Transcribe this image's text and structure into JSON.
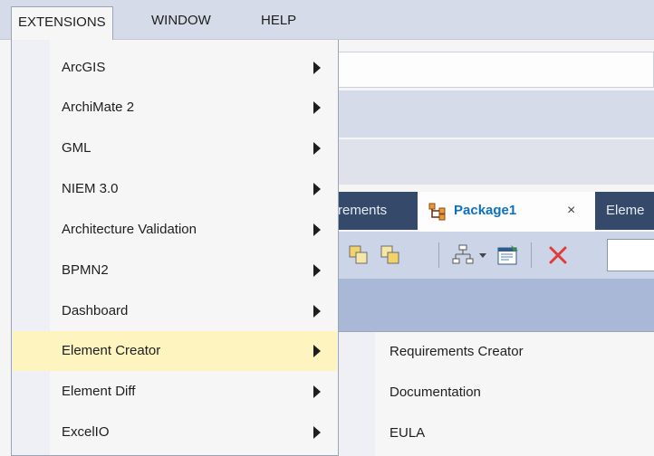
{
  "menubar": {
    "items": [
      {
        "label": "EXTENSIONS",
        "open": true
      },
      {
        "label": "WINDOW"
      },
      {
        "label": "HELP"
      }
    ]
  },
  "extensions_menu": {
    "items": [
      {
        "label": "ArcGIS",
        "has_submenu": true
      },
      {
        "label": "ArchiMate 2",
        "has_submenu": true
      },
      {
        "label": "GML",
        "has_submenu": true
      },
      {
        "label": "NIEM 3.0",
        "has_submenu": true
      },
      {
        "label": "Architecture Validation",
        "has_submenu": true
      },
      {
        "label": "BPMN2",
        "has_submenu": true
      },
      {
        "label": "Dashboard",
        "has_submenu": true
      },
      {
        "label": "Element Creator",
        "has_submenu": true,
        "highlighted": true
      },
      {
        "label": "Element Diff",
        "has_submenu": true
      },
      {
        "label": "ExcelIO",
        "has_submenu": true
      }
    ]
  },
  "element_creator_submenu": {
    "items": [
      {
        "label": "Requirements Creator"
      },
      {
        "label": "Documentation"
      },
      {
        "label": "EULA"
      }
    ]
  },
  "tabs": [
    {
      "label": "rements",
      "active": false
    },
    {
      "label": "Package1",
      "active": true,
      "icon": "package-icon",
      "close_label": "×"
    },
    {
      "label": "Eleme",
      "active": false
    }
  ],
  "toolbar": {
    "icons": [
      "layer-front-icon",
      "layer-back-icon",
      "hierarchy-icon",
      "properties-icon",
      "delete-icon"
    ]
  },
  "colors": {
    "menubar": "#d6dbe9",
    "menu_bg": "#f6f6f6",
    "highlight": "#fdf4bf",
    "tabstrip": "#35496a",
    "active_tab_text": "#0e70c0",
    "delete_red": "#e23b3b"
  }
}
